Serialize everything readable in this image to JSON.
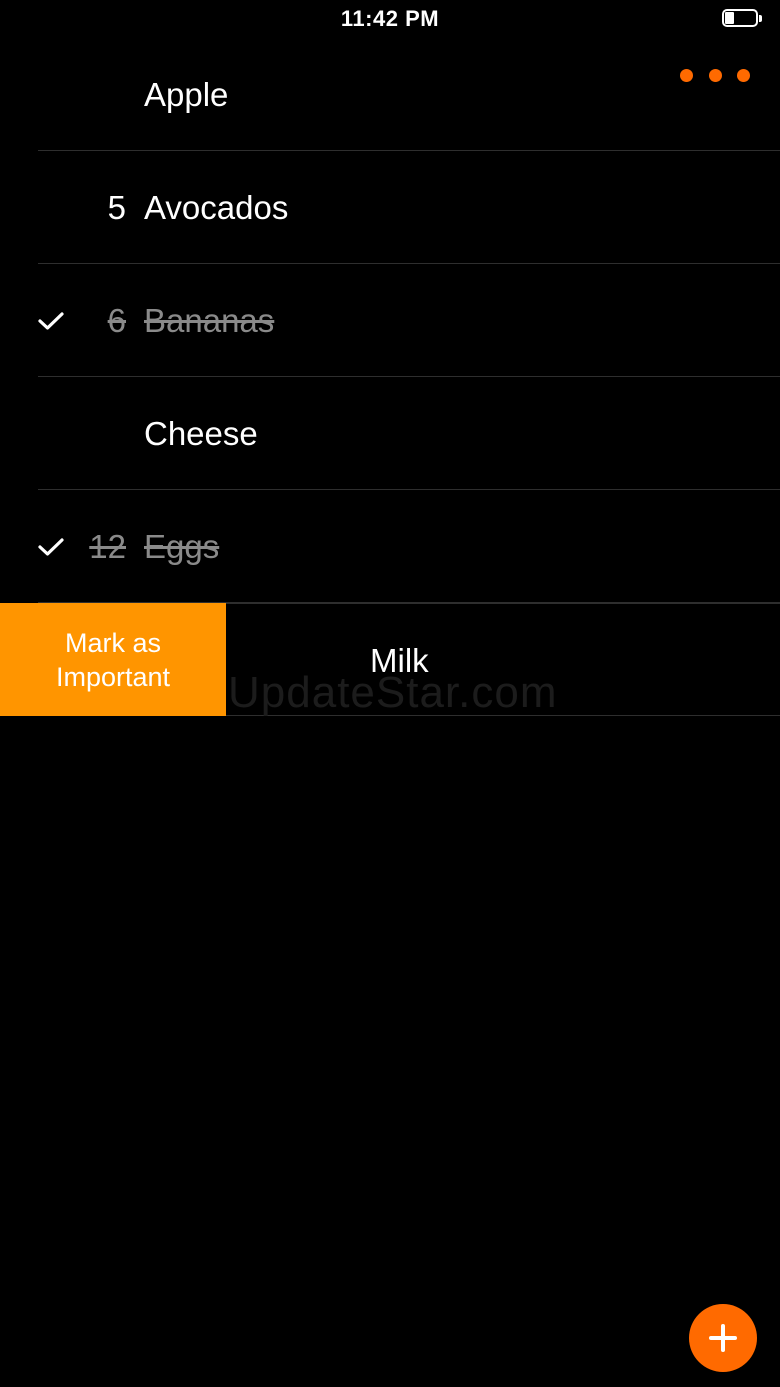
{
  "status_bar": {
    "time": "11:42 PM",
    "battery_level": 0.3
  },
  "header": {
    "more_icon": "ellipsis-icon",
    "accent_color": "#ff6a00"
  },
  "items": [
    {
      "qty": "",
      "name": "Apple",
      "done": false
    },
    {
      "qty": "5",
      "name": "Avocados",
      "done": false
    },
    {
      "qty": "6",
      "name": "Bananas",
      "done": true
    },
    {
      "qty": "",
      "name": "Cheese",
      "done": false
    },
    {
      "qty": "12",
      "name": "Eggs",
      "done": true
    }
  ],
  "swiped_item": {
    "name": "Milk",
    "action_label_line1": "Mark as",
    "action_label_line2": "Important",
    "action_color": "#ff9500"
  },
  "watermark": "UpdateStar.com",
  "fab": {
    "icon": "plus-icon"
  }
}
